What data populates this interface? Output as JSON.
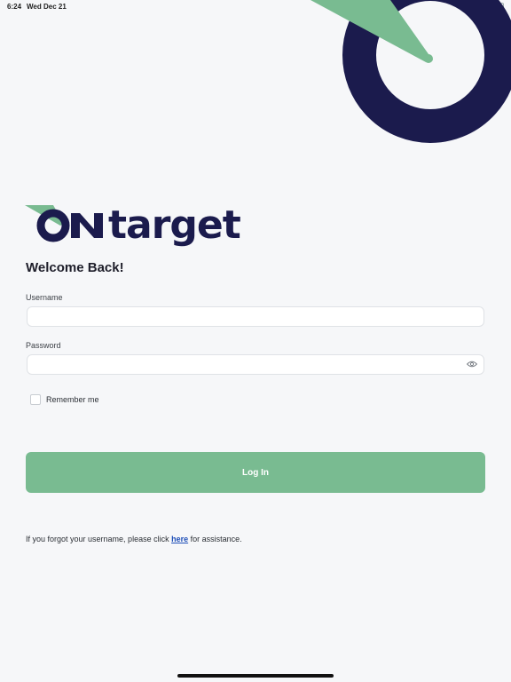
{
  "status_bar": {
    "time": "6:24",
    "date": "Wed Dec 21"
  },
  "icons": {
    "target": "target-graphic-icon",
    "eye": "eye-icon",
    "wifi": "wifi-icon",
    "battery": "battery-icon"
  },
  "colors": {
    "brand_navy": "#1b1b4d",
    "brand_green": "#79bb91",
    "link": "#1f4fb8",
    "background": "#f6f7f9"
  },
  "logo": {
    "text": "ONtarget"
  },
  "form": {
    "heading": "Welcome Back!",
    "username_label": "Username",
    "username_value": "",
    "password_label": "Password",
    "password_value": "",
    "remember_label": "Remember me",
    "remember_checked": false,
    "login_label": "Log In"
  },
  "footer": {
    "forgot_prefix": "If you forgot your username, please click",
    "forgot_link": "here",
    "forgot_suffix": "for assistance."
  }
}
